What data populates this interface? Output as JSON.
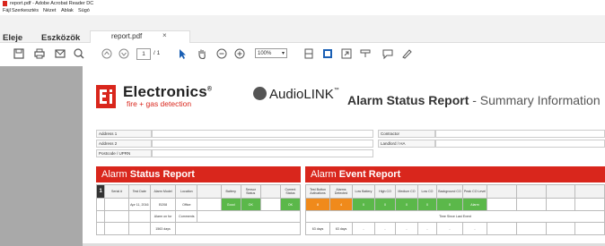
{
  "window": {
    "title": "report.pdf - Adobe Acrobat Reader DC"
  },
  "menu": {
    "items": [
      "Fájl",
      "Szerkesztés",
      "Nézet",
      "Ablak",
      "Súgó"
    ]
  },
  "tabs": {
    "home": "Eleje",
    "tools": "Eszközök",
    "doc": "report.pdf",
    "close": "×"
  },
  "toolbar": {
    "page_current": "1",
    "page_total": "/ 1",
    "zoom": "100%"
  },
  "doc": {
    "brand": "Electronics",
    "brand_reg": "®",
    "brand_sub": "fire + gas detection",
    "audiolink": "AudioLINK",
    "audiolink_tm": "™",
    "report_title_bold": "Alarm Status Report",
    "report_title_rest": "- Summary Information",
    "info_left": [
      "Address 1",
      "Address 2",
      "Postcode / UPRN"
    ],
    "info_right": [
      "Contractor",
      "Landlord / HA"
    ],
    "section_alarm_prefix": "Alarm ",
    "section_alarm_bold": "Status Report",
    "section_event_prefix": "Alarm ",
    "section_event_bold": "Event Report",
    "alarm_table": {
      "headers": [
        "Serial #",
        "Test Date",
        "Alarm Model",
        "Location",
        "Battery",
        "Sensor Status",
        "Current Status"
      ],
      "row_num": "1",
      "row": {
        "test_date": "Apr 11, 2016",
        "model": "Ei208",
        "location": "Office",
        "battery": "Good",
        "sensor": "OK",
        "current": "OK"
      },
      "row2": {
        "alarm_on_for": "Alarm on for",
        "comments": "Comments",
        "days": "1563 days"
      }
    },
    "event_table": {
      "headers": [
        "Test Button Activations",
        "Alarms Detected",
        "Low Battery",
        "High CO",
        "Medium CO",
        "Low CO",
        "Background CO",
        "Peak CO Level"
      ],
      "values": [
        "8",
        "4",
        "0",
        "0",
        "0",
        "0",
        "0",
        "Alarm"
      ],
      "time_since": "Time Since Last Event",
      "days": [
        "63 days",
        "63 days",
        "-",
        "-",
        "-",
        "-",
        "-",
        "-"
      ]
    }
  }
}
